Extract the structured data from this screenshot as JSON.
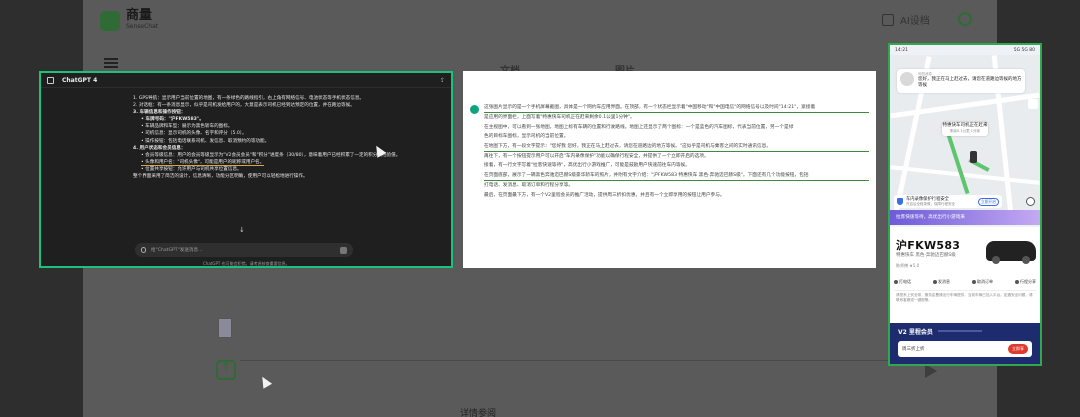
{
  "background": {
    "logo_text": "商量",
    "logo_sub": "SenseChat",
    "user_label": "AI设档",
    "tab1": "文档",
    "tab2": "图片",
    "footer_text": "详情参阅"
  },
  "chatgpt": {
    "title": "ChatGPT 4",
    "share_icon": "share-icon",
    "lines": [
      {
        "level": 1,
        "text": "1. GPS导航：显示用户当前位置的地图，有一条绿色的路线指引，右上角有网络信号、电池状态等手机状态信息。"
      },
      {
        "level": 1,
        "text": "2. 对话框：有一条消息显示，似乎是司机发给用户的，大意是表示司机已经到达预定的位置，并在路边等候。"
      },
      {
        "level": 1,
        "text": "3. 车辆信息和操作按钮：",
        "bold": true
      },
      {
        "level": 2,
        "text": "• 车牌号码：\"沪FKW583\"。",
        "bold": true
      },
      {
        "level": 2,
        "text": "• 车辆品牌和车型：展示为黑色轿车的图标。"
      },
      {
        "level": 2,
        "text": "• 司机信息：显示司机的头像、名字和评分（5.0）。"
      },
      {
        "level": 2,
        "text": "• 操作按钮：包括电话联系司机、发信息、取消预约的等功能。"
      },
      {
        "level": 1,
        "text": "4. 用户状态和会员信息：",
        "bold": true
      },
      {
        "level": 2,
        "text": "• 会员等级信息：用户的会员等级显示为\"V2会员会员\"和\"积分\"进度条（30/80），意味着用户已经积累了一定的积分或经验值。"
      },
      {
        "level": 2,
        "text": "• 头像和用户名：\"司机头像\"，可能是用户的昵称或用户名。",
        "underline": true
      },
      {
        "level": 2,
        "text": "• 位置共享按钮：允许用户与司机共享位置信息。"
      },
      {
        "level": 1,
        "text": "整个界面采用了简洁的设计，信息清晰，功能分区明确，使用户可以轻松地进行操作。"
      }
    ],
    "input_placeholder": "给\"ChatGPT\"发送消息…",
    "footer": "ChatGPT 也可能会犯错。请考虑核查重要信息。"
  },
  "analysis": {
    "paragraphs": [
      "这张图片显示的是一个手机屏幕截图，具体是一个网约车应用界面。在顶部，有一个状态栏显示着\"中国移动\"和\"中国电信\"的网络信号以及时间\"14:21\"，紧接着",
      "是应用的界面栏，上面写着\"特惠快车司机正在赶来剩余0.1公里1分钟\"。",
      "在主视图中，可以看到一张地图，地图上标有车辆的位置和行驶路线。地图上还显示了两个图标：一个是蓝色的汽车图标，代表当前位置，另一个是绿",
      "色的目标车图标，显示司机的当前位置。",
      "在地图下方，有一段文字提示：\"您好我 您好，我正在马上赶过去，请您在道路边的地方等候。\"这似乎是司机与乘客之间的实时通讯信息。",
      "再往下，有一个按钮提示用户可以开启\"车内录像保护\"功能以确保行程安全，并提供了一个立即开启的选项。",
      "接着，有一行文字写着\"拉客快速等待\"，高优出行小游戏推广，可能是鼓励用户快速前往车内等候。",
      "在页面底部，展示了一辆黑色奔驰迈巴赫S级豪华轿车的照片，并附有文字介绍：\"沪FKW583 特惠快车 黑色·奔驰迈巴赫S级\"。下面还有几个功能按钮，包括",
      "打电话、发消息、取消订单和行程分享等。",
      "最后，在页面最下方，有一个V2里程会员的推广活动，提供周三折扣优惠，并且有一个立即享用的按钮让用户参与。"
    ]
  },
  "phone": {
    "status_left": "14:21",
    "status_right": "5G 5G 80",
    "message_name": "司机消息",
    "message_text": "您好，我正在马上赶过去，请您在道路边等候的地方等候",
    "arrive_title": "特惠快车司机正在赶来",
    "arrive_sub": "剩余0.1公里 1分钟",
    "protection_title": "车内录像保护行程安全",
    "protection_sub": "开启后全程录像，保障行程安全",
    "protection_button": "立即开启",
    "banner_text": "拉客快速等待，高优出行小游戏来",
    "plate": "沪FKW583",
    "car_model": "特惠快车 黑色·奔驰迈巴赫S级",
    "driver": "陈师傅 ★5.0",
    "actions": [
      {
        "label": "打电话",
        "icon": "phone-icon"
      },
      {
        "label": "发消息",
        "icon": "message-icon"
      },
      {
        "label": "取消订单",
        "icon": "cancel-icon"
      },
      {
        "label": "行程分享",
        "icon": "share-icon"
      }
    ],
    "notice": "请您系上安全带，服务由曹操出行车辆提供，当前车辆已加入平台。如遇安全问题，请联系客服或一键报警。",
    "vip_title": "V2 里程会员",
    "vip_row_text": "周三折上折",
    "vip_button": "立即享"
  }
}
